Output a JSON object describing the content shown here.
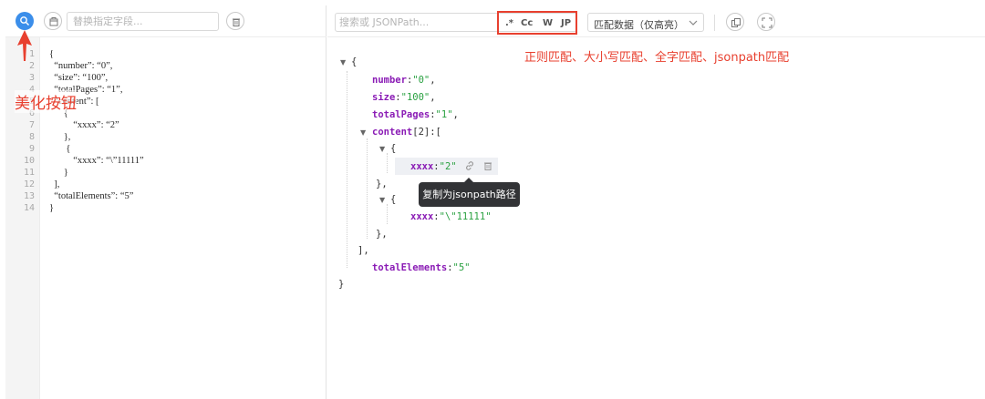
{
  "left_toolbar": {
    "replace_placeholder": "替换指定字段...",
    "beautify_icon": "search-icon",
    "copy_icon": "copy-icon",
    "delete_icon": "trash-icon"
  },
  "editor": {
    "line_numbers": [
      "1",
      "2",
      "3",
      "4",
      "5",
      "6",
      "7",
      "8",
      "9",
      "10",
      "11",
      "12",
      "13",
      "14"
    ],
    "lines": [
      "{",
      "  “number”: “0”,",
      "  “size”: “100”,",
      "  “totalPages”: “1”,",
      "  “content”: [",
      "      {",
      "          “xxxx”: “2”",
      "      },",
      "       {",
      "          “xxxx”: “\\”11111”",
      "      }",
      "  ],",
      "  “totalElements”: “5”",
      "}"
    ]
  },
  "annotations": {
    "beautify": "美化按钮",
    "match_options": "正则匹配、大小写匹配、全字匹配、jsonpath匹配"
  },
  "right_toolbar": {
    "search_placeholder": "搜索或 JSONPath...",
    "options": {
      "regex": ".*",
      "case": "Cc",
      "word": "W",
      "jsonpath": "JP"
    },
    "mode_select": "匹配数据（仅高亮）",
    "copy_icon": "copy-icon",
    "fullscreen_icon": "fullscreen-icon"
  },
  "tree": {
    "root_open": "{",
    "number_key": "number",
    "number_val": "\"0\"",
    "size_key": "size",
    "size_val": "\"100\"",
    "totalPages_key": "totalPages",
    "totalPages_val": "\"1\"",
    "content_key": "content",
    "content_count": "[2]",
    "obj_open": "{",
    "obj_close": "},",
    "item1_key": "xxxx",
    "item1_val": "\"2\"",
    "item2_key": "xxxx",
    "item2_val": "\"\\\"11111\"",
    "array_close": "],",
    "totalElements_key": "totalElements",
    "totalElements_val": "\"5\"",
    "root_close": "}"
  },
  "tooltip": "复制为jsonpath路径",
  "colors": {
    "accent": "#3b8eea",
    "annotation": "#e8402f",
    "key": "#8a1bb5",
    "string": "#2aa141"
  }
}
